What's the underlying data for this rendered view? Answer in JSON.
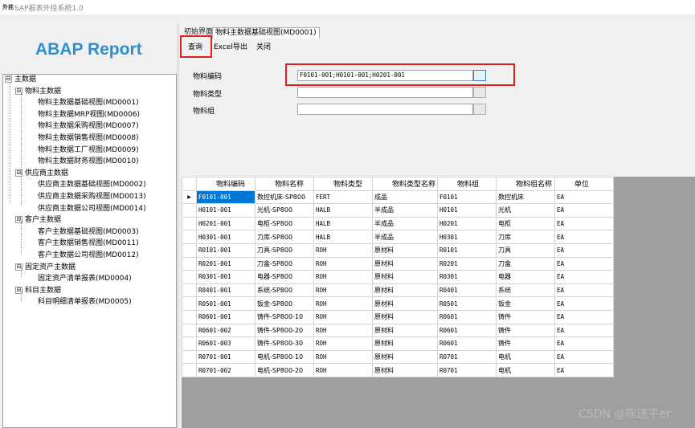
{
  "window": {
    "icon": "外挂",
    "title": "SAP报表外挂系统1.0"
  },
  "logo": "ABAP Report",
  "tree": [
    {
      "label": "主数据",
      "level": 0,
      "expand": "⊟"
    },
    {
      "label": "物料主数据",
      "level": 1,
      "expand": "⊟"
    },
    {
      "label": "物料主数据基础视图(MD0001)",
      "level": 2
    },
    {
      "label": "物料主数据MRP视图(MD0006)",
      "level": 2
    },
    {
      "label": "物料主数据采购视图(MD0007)",
      "level": 2
    },
    {
      "label": "物料主数据销售视图(MD0008)",
      "level": 2
    },
    {
      "label": "物料主数据工厂视图(MD0009)",
      "level": 2
    },
    {
      "label": "物料主数据财务视图(MD0010)",
      "level": 2
    },
    {
      "label": "供应商主数据",
      "level": 1,
      "expand": "⊟"
    },
    {
      "label": "供应商主数据基础视图(MD0002)",
      "level": 2
    },
    {
      "label": "供应商主数据采购视图(MD0013)",
      "level": 2
    },
    {
      "label": "供应商主数据公司视图(MD0014)",
      "level": 2
    },
    {
      "label": "客户主数据",
      "level": 1,
      "expand": "⊟"
    },
    {
      "label": "客户主数据基础视图(MD0003)",
      "level": 2
    },
    {
      "label": "客户主数据销售视图(MD0011)",
      "level": 2
    },
    {
      "label": "客户主数据公司视图(MD0012)",
      "level": 2
    },
    {
      "label": "固定资产主数据",
      "level": 1,
      "expand": "⊟"
    },
    {
      "label": "固定资产清单报表(MD0004)",
      "level": 2
    },
    {
      "label": "科目主数据",
      "level": 1,
      "expand": "⊟"
    },
    {
      "label": "科目明细清单报表(MD0005)",
      "level": 2
    }
  ],
  "tabs": {
    "home": "初始界面",
    "active": "物料主数据基础视图(MD0001)"
  },
  "toolbar": {
    "query": "查询",
    "excel": "Excel导出",
    "close": "关闭"
  },
  "form": {
    "material_code_label": "物料编码",
    "material_code_value": "F0101-001;H0101-001;H0201-001",
    "material_type_label": "物料类型",
    "material_type_value": "",
    "material_group_label": "物料组",
    "material_group_value": ""
  },
  "grid": {
    "columns": [
      "物料编码",
      "物料名称",
      "物料类型",
      "物料类型名称",
      "物料组",
      "物料组名称",
      "单位"
    ],
    "rows": [
      [
        "F0101-001",
        "数控机床-SP800",
        "FERT",
        "成品",
        "F0101",
        "数控机床",
        "EA"
      ],
      [
        "H0101-001",
        "光机-SP800",
        "HALB",
        "半成品",
        "H0101",
        "光机",
        "EA"
      ],
      [
        "H0201-001",
        "电柜-SP800",
        "HALB",
        "半成品",
        "H0201",
        "电柜",
        "EA"
      ],
      [
        "H0301-001",
        "刀库-SP800",
        "HALB",
        "半成品",
        "H0301",
        "刀库",
        "EA"
      ],
      [
        "R0101-001",
        "刀具-SP800",
        "ROH",
        "原材料",
        "R0101",
        "刀具",
        "EA"
      ],
      [
        "R0201-001",
        "刀盒-SP800",
        "ROH",
        "原材料",
        "R0201",
        "刀盒",
        "EA"
      ],
      [
        "R0301-001",
        "电器-SP800",
        "ROH",
        "原材料",
        "R0301",
        "电器",
        "EA"
      ],
      [
        "R0401-001",
        "系统-SP800",
        "ROH",
        "原材料",
        "R0401",
        "系统",
        "EA"
      ],
      [
        "R0501-001",
        "钣金-SP800",
        "ROH",
        "原材料",
        "R0501",
        "钣金",
        "EA"
      ],
      [
        "R0601-001",
        "铸件-SP800-10",
        "ROH",
        "原材料",
        "R0601",
        "铸件",
        "EA"
      ],
      [
        "R0601-002",
        "铸件-SP800-20",
        "ROH",
        "原材料",
        "R0601",
        "铸件",
        "EA"
      ],
      [
        "R0601-003",
        "铸件-SP800-30",
        "ROH",
        "原材料",
        "R0601",
        "铸件",
        "EA"
      ],
      [
        "R0701-001",
        "电机-SP800-10",
        "ROH",
        "原材料",
        "R0701",
        "电机",
        "EA"
      ],
      [
        "R0701-002",
        "电机-SP800-20",
        "ROH",
        "原材料",
        "R0701",
        "电机",
        "EA"
      ]
    ],
    "current_row_marker": "▶"
  },
  "watermark": "CSDN @陈送平er",
  "colors": {
    "logo": "#2e8fd0",
    "highlight": "#e02020",
    "selection": "#0078d7"
  }
}
